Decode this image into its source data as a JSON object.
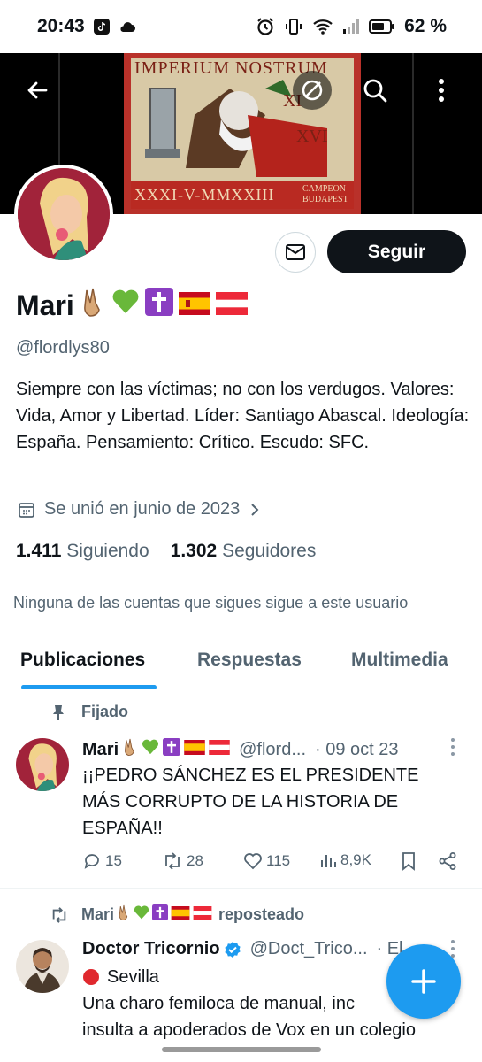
{
  "status_bar": {
    "time": "20:43",
    "battery": "62 %"
  },
  "banner": {
    "top_text": "IMPERIUM NOSTRUM",
    "bottom_text": "XXXI-V-MMXXIII",
    "bottom_small_1": "CAMPEON",
    "bottom_small_2": "BUDAPEST"
  },
  "profile": {
    "name": "Mari",
    "handle": "@flordlys80",
    "bio": "Siempre con las víctimas; no con los verdugos. Valores: Vida, Amor y Libertad. Líder: Santiago Abascal. Ideología: España. Pensamiento: Crítico. Escudo: SFC.",
    "joined": "Se unió en junio de 2023",
    "following_count": "1.411",
    "following_label": "Siguiendo",
    "followers_count": "1.302",
    "followers_label": "Seguidores",
    "mutual_text": "Ninguna de las cuentas que sigues sigue a este usuario",
    "follow_label": "Seguir"
  },
  "tabs": [
    {
      "label": "Publicaciones",
      "active": true
    },
    {
      "label": "Respuestas",
      "active": false
    },
    {
      "label": "Multimedia",
      "active": false
    }
  ],
  "tweets": [
    {
      "context": "Fijado",
      "name": "Mari",
      "handle": "@flord...",
      "date": "· 09 oct 23",
      "text": "¡¡PEDRO SÁNCHEZ ES EL PRESIDENTE MÁS CORRUPTO DE LA HISTORIA DE ESPAÑA!!",
      "replies": "15",
      "reposts": "28",
      "likes": "115",
      "views": "8,9K"
    },
    {
      "context_name": "Mari",
      "context": "reposteado",
      "name": "Doctor Tricornio",
      "handle": "@Doct_Trico...",
      "date": "· El",
      "line1": "Sevilla",
      "line2": "Una charo femiloca de manual, inc",
      "line3": "insulta a apoderados de Vox en un colegio"
    }
  ],
  "colors": {
    "accent": "#1d9bf0",
    "text": "#0f1419",
    "secondary": "#536471",
    "follow_bg": "#0f1419"
  }
}
